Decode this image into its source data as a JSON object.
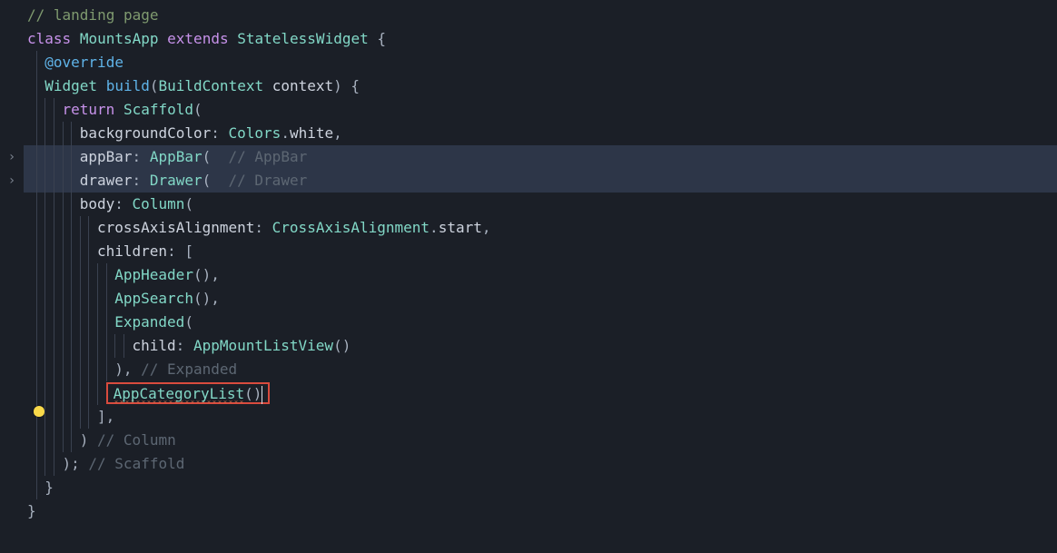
{
  "comment_landing": "// landing page",
  "l2": {
    "class_kw": "class",
    "class_name": "MountsApp",
    "extends_kw": "extends",
    "base": "StatelessWidget",
    "open": " {"
  },
  "l3": {
    "at": "@",
    "override": "override"
  },
  "l4": {
    "ret": "Widget",
    "method": "build",
    "paren_open": "(",
    "param_type": "BuildContext",
    "param_name": " context",
    "paren_close": ")",
    "open": " {"
  },
  "l5": {
    "return": "return",
    "call": "Scaffold",
    "open": "("
  },
  "l6": {
    "name": "backgroundColor",
    "cls": "Colors",
    "dot": ".",
    "val": "white",
    "comma": ","
  },
  "l7": {
    "name": "appBar",
    "cls": "AppBar",
    "open": "(",
    "cm": "  // AppBar"
  },
  "l8": {
    "name": "drawer",
    "cls": "Drawer",
    "open": "(",
    "cm": "  // Drawer"
  },
  "l9": {
    "name": "body",
    "cls": "Column",
    "open": "("
  },
  "l10": {
    "name": "crossAxisAlignment",
    "cls": "CrossAxisAlignment",
    "dot": ".",
    "val": "start",
    "comma": ","
  },
  "l11": {
    "name": "children",
    "open": ": ["
  },
  "l12": {
    "cls": "AppHeader",
    "rest": "(),"
  },
  "l13": {
    "cls": "AppSearch",
    "rest": "(),"
  },
  "l14": {
    "cls": "Expanded",
    "open": "("
  },
  "l15": {
    "name": "child",
    "cls": "AppMountListView",
    "rest": "()"
  },
  "l16": {
    "close": "),",
    "cm": " // Expanded"
  },
  "l17": {
    "cls": "AppCategoryList",
    "rest": "()"
  },
  "l18": {
    "close": "],"
  },
  "l19": {
    "close": ")",
    "cm": " // Column"
  },
  "l20": {
    "close": ");",
    "cm": " // Scaffold"
  },
  "l21": {
    "close": "}"
  },
  "l22": {
    "close": "}"
  }
}
